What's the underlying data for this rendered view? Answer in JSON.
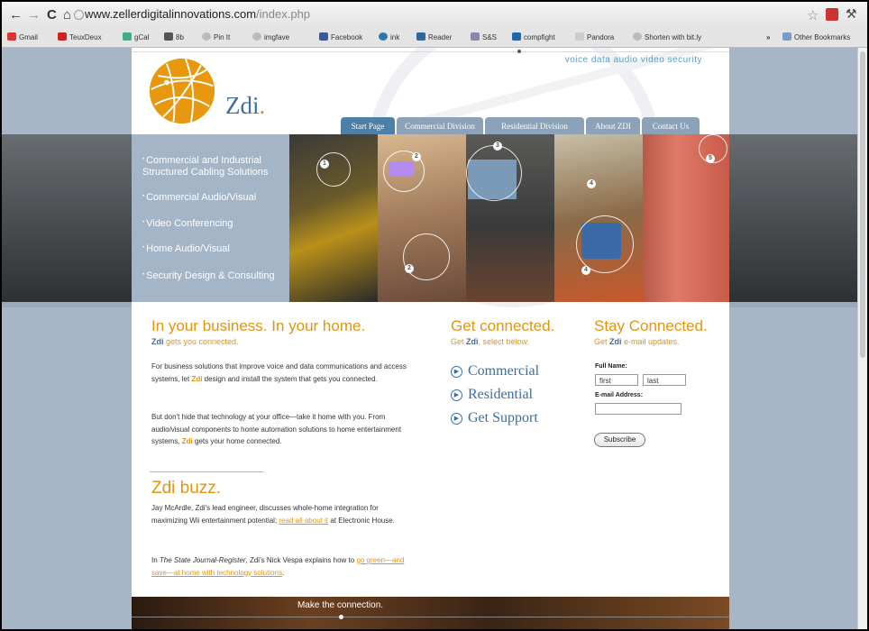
{
  "browser": {
    "url_host": "www.zellerdigitalinnovations.com",
    "url_path": "/index.php",
    "bookmarks": [
      {
        "label": "Gmail",
        "color": "#d33"
      },
      {
        "label": "TeuxDeux",
        "color": "#c22"
      },
      {
        "label": "gCal",
        "color": "#4a8"
      },
      {
        "label": "8b",
        "color": "#555"
      },
      {
        "label": "Pin It",
        "color": "#999"
      },
      {
        "label": "imgfave",
        "color": "#999"
      },
      {
        "label": "Facebook",
        "color": "#3b5998"
      },
      {
        "label": "ink",
        "color": "#37a"
      },
      {
        "label": "Reader",
        "color": "#369"
      },
      {
        "label": "S&S",
        "color": "#88a"
      },
      {
        "label": "compfight",
        "color": "#26a"
      },
      {
        "label": "Pandora",
        "color": "#aaa"
      },
      {
        "label": "Shorten with bit.ly",
        "color": "#999"
      }
    ],
    "other_bookmarks": "Other Bookmarks"
  },
  "site": {
    "tagline": "voice  data  audio  video  security",
    "logo_name": "Zdi",
    "logo_dot": ".",
    "nav_tabs": [
      "Start Page",
      "Commercial Division",
      "Residential Division",
      "About ZDI",
      "Contact Us"
    ],
    "menu": [
      "Commercial and Industrial Structured Cabling Solutions",
      "Commercial Audio/Visual",
      "Video Conferencing",
      "Home Audio/Visual",
      "Security Design & Consulting"
    ],
    "photo_numbers": [
      "1",
      "2",
      "3",
      "4",
      "5"
    ],
    "main": {
      "heading": "In your business. In your home.",
      "sub_brand": "Zdi",
      "sub_rest": " gets you connected.",
      "p1_a": "For business solutions that improve voice and data communications and access systems, let ",
      "p1_brand": "Zdi",
      "p1_b": " design and install the system that gets you connected.",
      "p2_a": "But don't hide that technology at your office—take it home with you. From audio/visual components to home automation solutions to home entertainment systems, ",
      "p2_brand": "Zdi",
      "p2_b": " gets your home connected."
    },
    "buzz": {
      "heading": "Zdi buzz.",
      "p1_a": "Jay McArdle, Zdi's lead engineer, discusses whole-home integration for maximizing Wii entertainment potential; ",
      "p1_link": "read all about it",
      "p1_b": " at Electronic House.",
      "p2_pub": "The State Journal-Register",
      "p2_a": "In ",
      "p2_b": ", Zdi's Nick Vespa explains how to ",
      "p2_link": "go green—and save—at home with technology solutions",
      "p2_c": "."
    },
    "get_connected": {
      "heading": "Get connected.",
      "sub_a": "Get ",
      "sub_brand": "Zdi",
      "sub_b": ", select below.",
      "links": [
        "Commercial",
        "Residential",
        "Get Support"
      ]
    },
    "stay_connected": {
      "heading": "Stay Connected.",
      "sub_a": "Get ",
      "sub_brand": "Zdi",
      "sub_b": " e-mail updates.",
      "full_name_label": "Full Name:",
      "first_value": "first",
      "last_value": "last",
      "email_label": "E-mail Address:",
      "email_value": "",
      "subscribe_label": "Subscribe"
    },
    "footer_text": "Make the connection."
  }
}
